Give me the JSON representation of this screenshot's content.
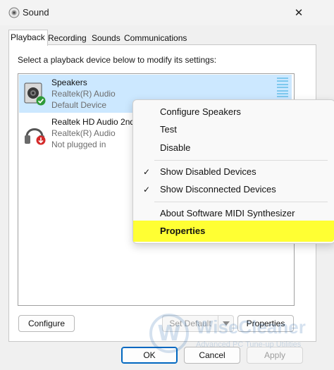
{
  "window": {
    "title": "Sound",
    "close_glyph": "✕",
    "icons": {
      "app": "speaker-icon",
      "close": "close-icon"
    }
  },
  "tabs": [
    {
      "label": "Playback",
      "active": true
    },
    {
      "label": "Recording",
      "active": false
    },
    {
      "label": "Sounds",
      "active": false
    },
    {
      "label": "Communications",
      "active": false
    }
  ],
  "playback": {
    "instruction": "Select a playback device below to modify its settings:",
    "devices": [
      {
        "name": "Speakers",
        "driver": "Realtek(R) Audio",
        "status": "Default Device",
        "selected": true,
        "icon": "speaker-device-icon",
        "badge": "green-check-badge-icon"
      },
      {
        "name": "Realtek HD Audio 2nd",
        "driver": "Realtek(R) Audio",
        "status": "Not plugged in",
        "selected": false,
        "icon": "headphones-icon",
        "badge": "red-down-arrow-badge-icon"
      }
    ]
  },
  "buttons": {
    "configure": "Configure",
    "set_default": "Set Default",
    "properties": "Properties",
    "ok": "OK",
    "cancel": "Cancel",
    "apply": "Apply"
  },
  "context_menu": {
    "items": [
      {
        "label": "Configure Speakers",
        "checked": false
      },
      {
        "label": "Test",
        "checked": false
      },
      {
        "label": "Disable",
        "checked": false
      },
      {
        "label": "Show Disabled Devices",
        "checked": true
      },
      {
        "label": "Show Disconnected Devices",
        "checked": true
      },
      {
        "label": "About Software MIDI Synthesizer",
        "checked": false
      },
      {
        "label": "Properties",
        "checked": false,
        "highlighted": true
      }
    ],
    "check_glyph": "✓",
    "highlight_color": "#ffff33"
  },
  "watermark": {
    "logo_letter": "W",
    "title": "WiseCleaner",
    "subtitle": "Advanced PC Tune-up Utilities"
  },
  "colors": {
    "selection": "#cce8ff",
    "accent": "#0067c0",
    "level_meter": "#7ec8ee",
    "check_badge": "#2e9a3a",
    "unplugged_badge": "#d42a2a"
  }
}
